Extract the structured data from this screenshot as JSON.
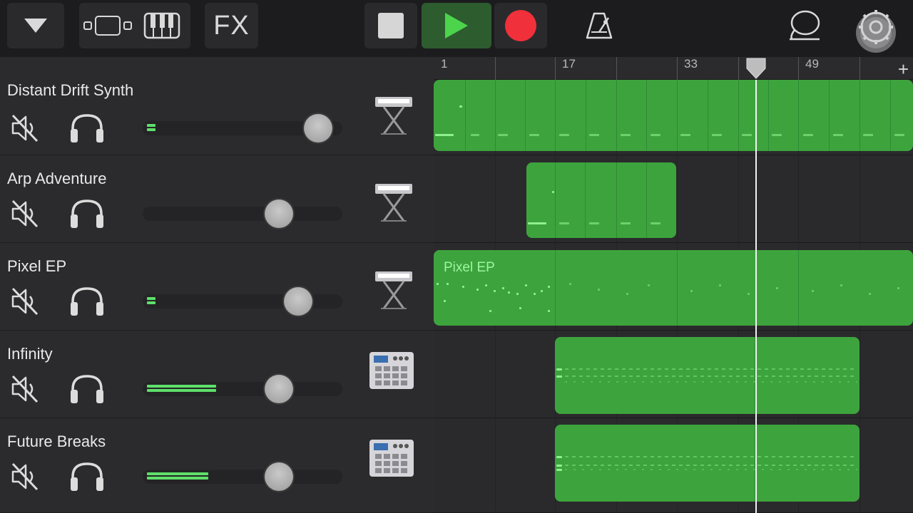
{
  "toolbar": {
    "fx_label": "FX",
    "icons": [
      "dropdown-triangle-icon",
      "tracks-view-icon",
      "keyboard-icon",
      "fx-icon",
      "stop-icon",
      "play-icon",
      "record-icon",
      "metronome-icon",
      "loop-browser-icon",
      "settings-gear-icon"
    ]
  },
  "ruler": {
    "labels": [
      "1",
      "17",
      "33",
      "49"
    ]
  },
  "tracks": [
    {
      "name": "Distant Drift Synth",
      "instrument_icon": "keyboard-stand-icon",
      "level": 0.05,
      "volume": 0.88
    },
    {
      "name": "Arp Adventure",
      "instrument_icon": "keyboard-stand-icon",
      "level": 0.0,
      "volume": 0.68
    },
    {
      "name": "Pixel EP",
      "instrument_icon": "keyboard-stand-icon",
      "level": 0.05,
      "volume": 0.78
    },
    {
      "name": "Infinity",
      "instrument_icon": "drum-machine-icon",
      "level": 0.38,
      "volume": 0.68
    },
    {
      "name": "Future Breaks",
      "instrument_icon": "drum-machine-icon",
      "level": 0.34,
      "volume": 0.68
    }
  ],
  "regions": {
    "pixel_ep_name": "Pixel EP"
  },
  "colors": {
    "region_green": "#3da43d",
    "note_green": "#8ff08f",
    "play_green": "#4cd44c",
    "record_red": "#f0303a",
    "meter_green": "#5ee06a"
  }
}
